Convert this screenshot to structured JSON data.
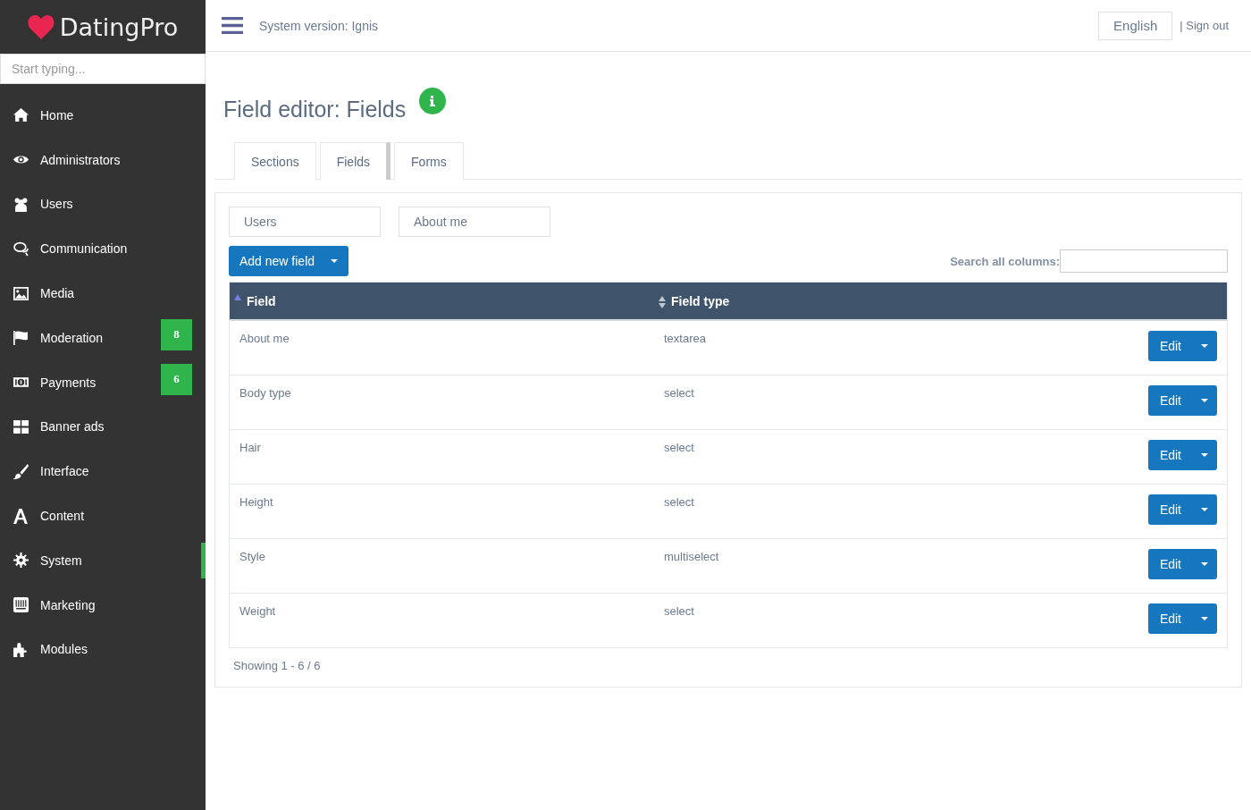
{
  "logo": {
    "text": "DatingPro"
  },
  "sidebar": {
    "search": {
      "placeholder": "Start typing..."
    },
    "items": [
      {
        "label": "Home",
        "selected": false
      },
      {
        "label": "Administrators",
        "selected": false
      },
      {
        "label": "Users",
        "selected": false
      },
      {
        "label": "Communication",
        "selected": false
      },
      {
        "label": "Media",
        "selected": false
      },
      {
        "label": "Moderation",
        "selected": false,
        "badge": "8"
      },
      {
        "label": "Payments",
        "selected": false,
        "badge": "6"
      },
      {
        "label": "Banner ads",
        "selected": false
      },
      {
        "label": "Interface",
        "selected": false
      },
      {
        "label": "Content",
        "selected": false
      },
      {
        "label": "System",
        "selected": true
      },
      {
        "label": "Marketing",
        "selected": false
      },
      {
        "label": "Modules",
        "selected": false
      }
    ]
  },
  "topbar": {
    "version": "System version: Ignis",
    "language": "English",
    "sign_out": "| Sign out"
  },
  "page": {
    "title": "Field editor: Fields",
    "tabs": [
      {
        "label": "Sections",
        "selected": false
      },
      {
        "label": "Fields",
        "selected": true
      },
      {
        "label": "Forms",
        "selected": false
      }
    ],
    "filters": [
      "Users",
      "About me"
    ],
    "add_button": "Add new field",
    "search_label": "Search all columns:",
    "table": {
      "columns": [
        {
          "label": "Field",
          "sorted": true
        },
        {
          "label": "Field type",
          "sorted": false
        }
      ],
      "rows": [
        {
          "field": "About me",
          "type": "textarea",
          "action": "Edit"
        },
        {
          "field": "Body type",
          "type": "select",
          "action": "Edit"
        },
        {
          "field": "Hair",
          "type": "select",
          "action": "Edit"
        },
        {
          "field": "Height",
          "type": "select",
          "action": "Edit"
        },
        {
          "field": "Style",
          "type": "multiselect",
          "action": "Edit"
        },
        {
          "field": "Weight",
          "type": "select",
          "action": "Edit"
        }
      ]
    },
    "footer": "Showing 1 - 6 / 6"
  }
}
